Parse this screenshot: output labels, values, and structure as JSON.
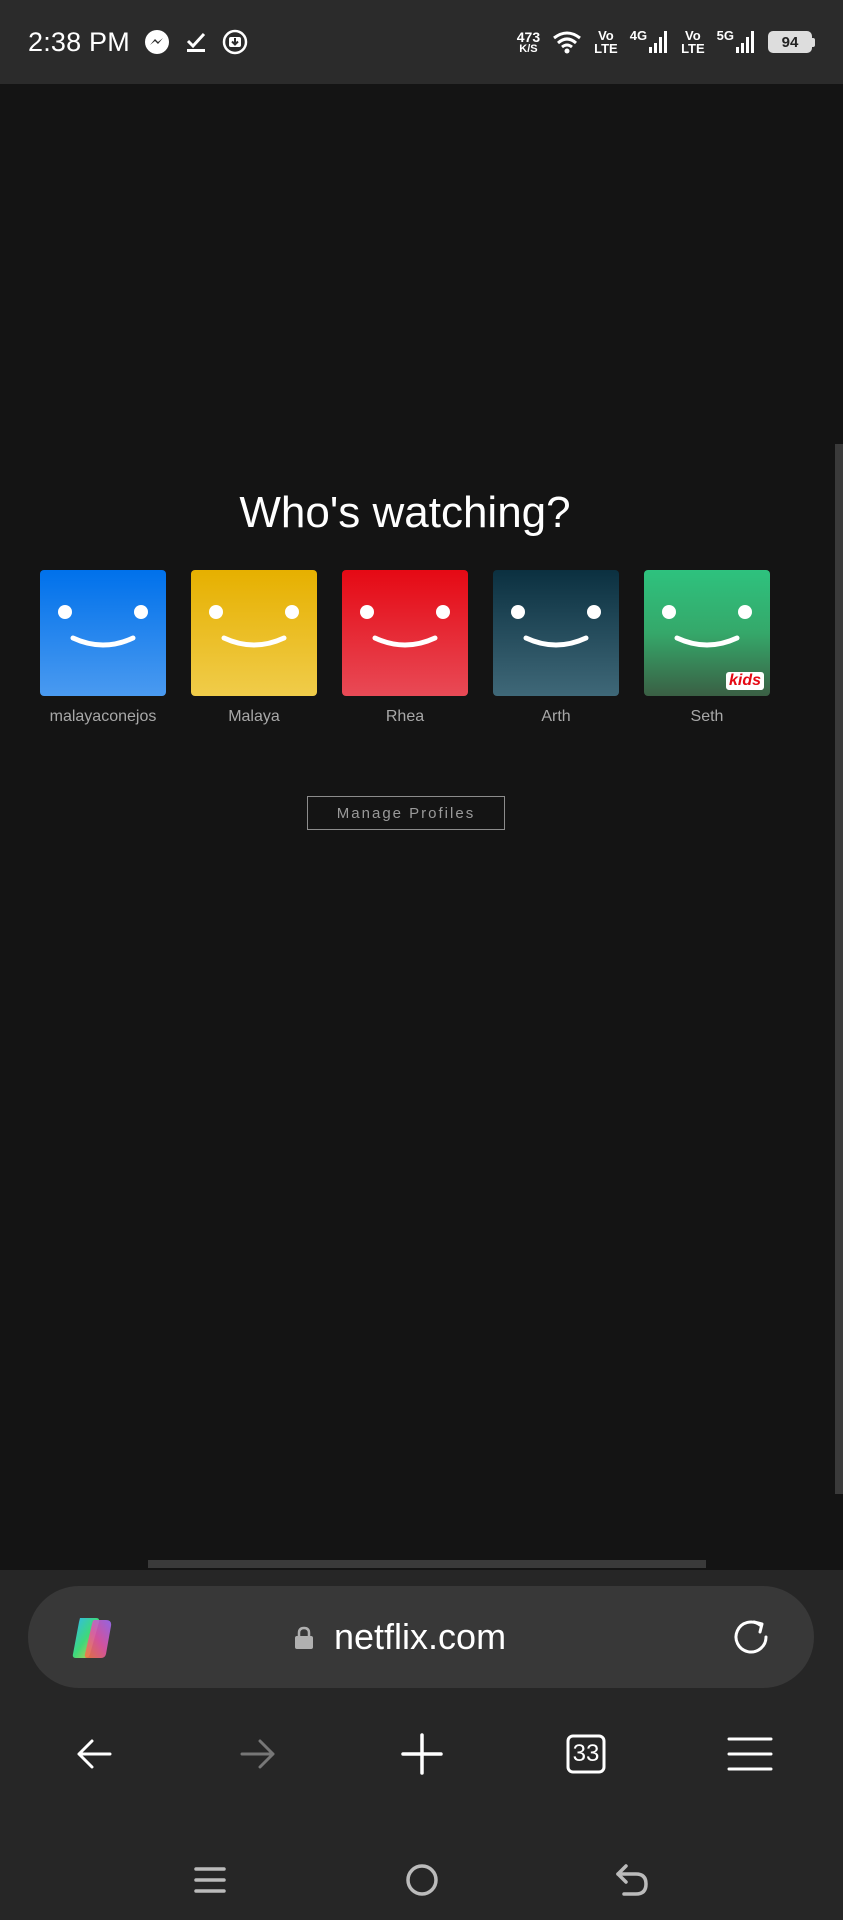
{
  "status_bar": {
    "time": "2:38 PM",
    "net_speed_value": "473",
    "net_speed_unit": "K/S",
    "sim1_label_top": "Vo",
    "sim1_label_bottom": "LTE",
    "sim1_network": "4G",
    "sim2_label_top": "Vo",
    "sim2_label_bottom": "LTE",
    "sim2_network": "5G",
    "battery": "94",
    "icons": [
      "messenger-icon",
      "checkmark-icon",
      "download-icon",
      "wifi-icon",
      "signal-icon",
      "battery-icon"
    ]
  },
  "page": {
    "title": "Who's watching?",
    "profiles": [
      {
        "name": "malayaconejos",
        "color_top": "#0071eb",
        "color_bottom": "#4a9af0",
        "kids": false
      },
      {
        "name": "Malaya",
        "color_top": "#e6b000",
        "color_bottom": "#f0cc4a",
        "kids": false
      },
      {
        "name": "Rhea",
        "color_top": "#e50914",
        "color_bottom": "#e84a56",
        "kids": false
      },
      {
        "name": "Arth",
        "color_top": "#0b3040",
        "color_bottom": "#3f6878",
        "kids": false
      },
      {
        "name": "Seth",
        "color_top": "#2ec27e",
        "color_bottom": "#3a5f44",
        "kids": true,
        "badge": "kids"
      }
    ],
    "manage_label": "Manage Profiles"
  },
  "browser": {
    "url": "netflix.com",
    "tab_count": "33",
    "icons": [
      "copilot-icon",
      "lock-icon",
      "reload-icon",
      "back-arrow-icon",
      "forward-arrow-icon",
      "new-tab-icon",
      "tabs-icon",
      "menu-icon"
    ]
  },
  "system_nav": {
    "icons": [
      "recent-apps-icon",
      "home-icon",
      "back-icon"
    ]
  },
  "colors": {
    "background": "#141414",
    "status_bar": "#2b2b2b",
    "browser_bar": "#262626",
    "url_pill": "#383838"
  }
}
